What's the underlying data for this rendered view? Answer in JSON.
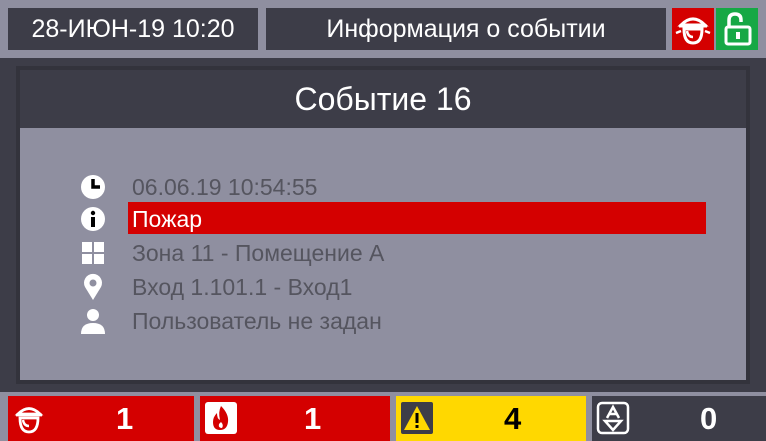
{
  "header": {
    "datetime": "28-ИЮН-19  10:20",
    "title": "Информация о событии",
    "alarm_icon": "fire-alarm-siren-icon",
    "lock_icon": "unlocked-padlock-icon"
  },
  "event": {
    "title": "Событие 16",
    "timestamp": "06.06.19  10:54:55",
    "type": "Пожар",
    "zone": "Зона 11 - Помещение А",
    "input": "Вход 1.101.1 - Вход1",
    "user": "Пользователь не задан"
  },
  "footer": {
    "alarm_count": "1",
    "fire_count": "1",
    "fault_count": "4",
    "disabled_count": "0"
  },
  "colors": {
    "background": "#3d3d48",
    "panel": "#8f8fa0",
    "alarm_red": "#d40000",
    "fault_yellow": "#ffd800",
    "unlock_green": "#16a845"
  }
}
